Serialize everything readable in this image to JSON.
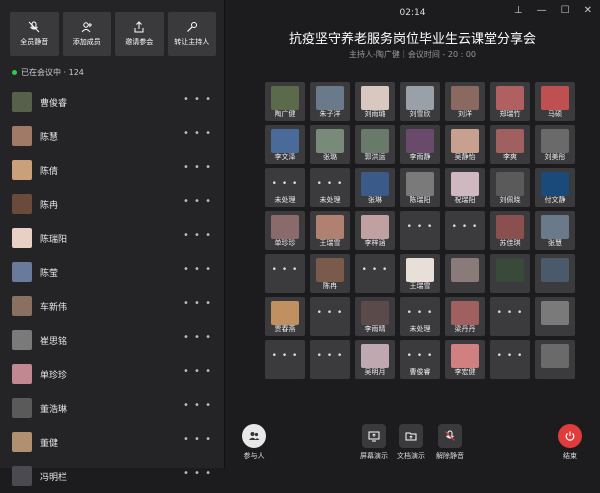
{
  "toolbar": {
    "buttons": [
      {
        "label": "全员静音",
        "icon": "mic-off-icon"
      },
      {
        "label": "添加成员",
        "icon": "add-user-icon"
      },
      {
        "label": "邀请参会",
        "icon": "share-icon"
      },
      {
        "label": "转让主持人",
        "icon": "transfer-host-icon"
      }
    ]
  },
  "status": {
    "text": "已在会议中 · 124",
    "color": "#2ecc40"
  },
  "participants": [
    {
      "name": "曹俊睿",
      "avatar": "#56604a"
    },
    {
      "name": "陈慧",
      "avatar": "#a07a66"
    },
    {
      "name": "陈倩",
      "avatar": "#c9a07a"
    },
    {
      "name": "陈冉",
      "avatar": "#6a4a3a"
    },
    {
      "name": "陈瑞阳",
      "avatar": "#e8d0c4"
    },
    {
      "name": "陈莹",
      "avatar": "#6a7a9a"
    },
    {
      "name": "车新伟",
      "avatar": "#8a7060"
    },
    {
      "name": "崔思铭",
      "avatar": "#7a7a7a"
    },
    {
      "name": "单珍珍",
      "avatar": "#c08890"
    },
    {
      "name": "董浩琳",
      "avatar": "#5a5a5a"
    },
    {
      "name": "董健",
      "avatar": "#b09070"
    },
    {
      "name": "冯明栏",
      "avatar": "#4a4a50"
    }
  ],
  "more_glyph": "• • •",
  "clock": "02:14",
  "window_controls": [
    "⊥",
    "—",
    "☐",
    "✕"
  ],
  "title": "抗疫坚守养老服务岗位毕业生云课堂分享会",
  "subtitle": "主持人-陶广健｜会议时间 - 20 : 00",
  "tiles": [
    {
      "name": "陶广健",
      "face": "#5a6a4a"
    },
    {
      "name": "朱子洋",
      "face": "#6a7a8a"
    },
    {
      "name": "刘雨璐",
      "face": "#d8c8c0"
    },
    {
      "name": "刘雪欣",
      "face": "#9aa0a8"
    },
    {
      "name": "刘洋",
      "face": "#8a6a60"
    },
    {
      "name": "郑瑞竹",
      "face": "#b06060"
    },
    {
      "name": "马硕",
      "face": "#c05050"
    },
    {
      "name": "李文泽",
      "face": "#4a6a9a"
    },
    {
      "name": "张璐",
      "face": "#7a8a7a"
    },
    {
      "name": "郭洪运",
      "face": "#6a7a6a"
    },
    {
      "name": "李雨静",
      "face": "#6a4a6a"
    },
    {
      "name": "吴静怡",
      "face": "#c8a090"
    },
    {
      "name": "李爽",
      "face": "#a06060"
    },
    {
      "name": "刘美彤",
      "face": "#6a6a6a"
    },
    {
      "name": "未处理",
      "face": ""
    },
    {
      "name": "未处理",
      "face": ""
    },
    {
      "name": "张琳",
      "face": "#3a5a8a"
    },
    {
      "name": "陈瑞阳",
      "face": "#7a7a7a"
    },
    {
      "name": "祝瑞阳",
      "face": "#d0b8c0"
    },
    {
      "name": "刘佩晓",
      "face": "#5a5a5a"
    },
    {
      "name": "付文静",
      "face": "#1a4a7a"
    },
    {
      "name": "单珍珍",
      "face": "#8a6a6a"
    },
    {
      "name": "王瑞雪",
      "face": "#b08070"
    },
    {
      "name": "李梓涵",
      "face": "#c0a0a0"
    },
    {
      "name": "",
      "face": ""
    },
    {
      "name": "",
      "face": ""
    },
    {
      "name": "苏佳琪",
      "face": "#8a5050"
    },
    {
      "name": "张慧",
      "face": "#6a7a8a"
    },
    {
      "name": "",
      "face": ""
    },
    {
      "name": "陈冉",
      "face": "#7a5a4a"
    },
    {
      "name": "",
      "face": ""
    },
    {
      "name": "王瑞雪",
      "face": "#e8e0d8"
    },
    {
      "name": "",
      "face": "#8a7a7a"
    },
    {
      "name": "",
      "face": "#3a4a3a"
    },
    {
      "name": "",
      "face": "#4a5a6a"
    },
    {
      "name": "贾春燕",
      "face": "#c09060"
    },
    {
      "name": "",
      "face": ""
    },
    {
      "name": "李雨晴",
      "face": "#5a4a4a"
    },
    {
      "name": "未处理",
      "face": ""
    },
    {
      "name": "梁丹丹",
      "face": "#a06060"
    },
    {
      "name": "",
      "face": ""
    },
    {
      "name": "",
      "face": "#7a7a7a"
    },
    {
      "name": "",
      "face": ""
    },
    {
      "name": "",
      "face": ""
    },
    {
      "name": "吴明月",
      "face": "#c0a8b0"
    },
    {
      "name": "曹俊睿",
      "face": ""
    },
    {
      "name": "李宏健",
      "face": "#d08080"
    },
    {
      "name": "",
      "face": ""
    },
    {
      "name": "",
      "face": "#6a6a6a"
    }
  ],
  "bottombar": {
    "participants_label": "参与人",
    "screen_share_label": "屏幕演示",
    "doc_share_label": "文档演示",
    "unmute_label": "解除静音",
    "end_label": "结束",
    "end_color": "#e03c3c"
  }
}
